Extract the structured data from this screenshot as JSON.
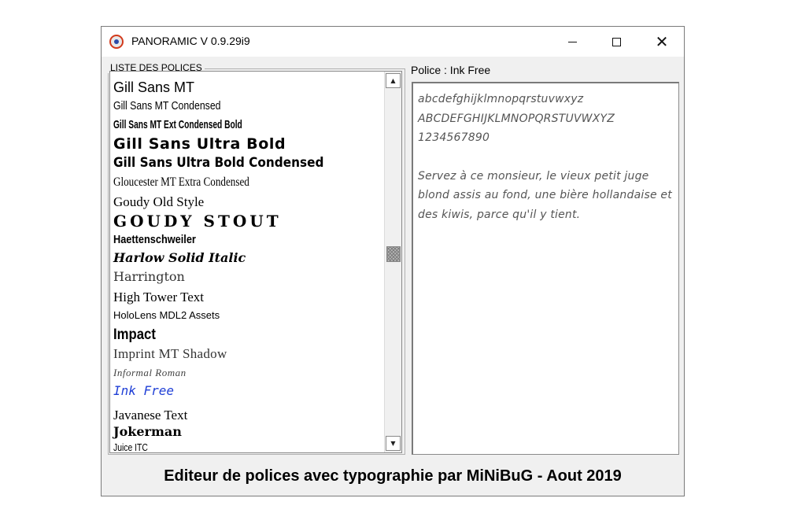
{
  "window": {
    "title": "PANORAMIC V 0.9.29i9",
    "icon": "panoramic-app-icon",
    "controls": {
      "minimize": "minimize-icon",
      "maximize": "maximize-icon",
      "close": "close-icon"
    }
  },
  "font_list": {
    "group_label": "LISTE DES POLICES",
    "items": [
      "Gill Sans MT",
      "Gill Sans MT Condensed",
      "Gill Sans MT Ext Condensed Bold",
      "Gill Sans Ultra Bold",
      "Gill Sans Ultra Bold Condensed",
      "Gloucester MT Extra Condensed",
      "Goudy Old Style",
      "GOUDY STOUT",
      "Haettenschweiler",
      "Harlow Solid Italic",
      "Harrington",
      "High Tower Text",
      "HoloLens MDL2 Assets",
      "Impact",
      "Imprint MT Shadow",
      "Informal Roman",
      "Ink Free",
      "Javanese Text",
      "Jokerman",
      "Juice ITC"
    ],
    "selected": "Ink Free",
    "selected_color": "#1f3fd6"
  },
  "preview": {
    "label": "Police : Ink Free",
    "lowercase": "abcdefghijklmnopqrstuvwxyz",
    "uppercase": "ABCDEFGHIJKLMNOPQRSTUVWXYZ",
    "digits": "1234567890",
    "sentence": "Servez à ce monsieur, le vieux petit juge blond assis au fond, une bière hollandaise et des kiwis, parce qu'il y tient."
  },
  "footer": {
    "text": "Editeur de polices avec typographie par MiNiBuG - Aout 2019"
  }
}
